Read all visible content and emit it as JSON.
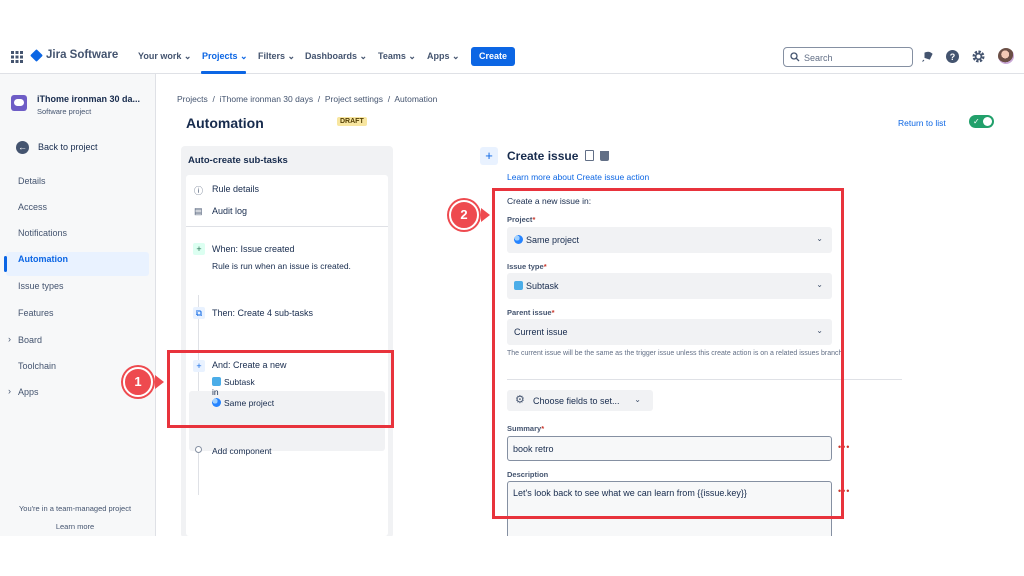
{
  "nav": {
    "brand": "Jira Software",
    "items": [
      "Your work",
      "Projects",
      "Filters",
      "Dashboards",
      "Teams",
      "Apps"
    ],
    "create_label": "Create",
    "search_placeholder": "Search"
  },
  "sidebar": {
    "project_name": "iThome ironman 30 da...",
    "project_type": "Software project",
    "back_label": "Back to project",
    "items": [
      "Details",
      "Access",
      "Notifications",
      "Automation",
      "Issue types",
      "Features",
      "Board",
      "Toolchain",
      "Apps"
    ],
    "active_item": "Automation",
    "team_note": "You're in a team-managed project",
    "learn_more": "Learn more"
  },
  "breadcrumb": [
    "Projects",
    "iThome ironman 30 days",
    "Project settings",
    "Automation"
  ],
  "page": {
    "title": "Automation",
    "status_badge": "DRAFT",
    "return_link": "Return to list",
    "enabled": true
  },
  "rule": {
    "name": "Auto-create sub-tasks",
    "details_label": "Rule details",
    "audit_label": "Audit log",
    "trigger_title": "When: Issue created",
    "trigger_desc": "Rule is run when an issue is created.",
    "action_title": "Then: Create 4 sub-tasks",
    "and_title": "And: Create a new",
    "and_issue_type": "Subtask",
    "and_in": "in",
    "and_project": "Same project",
    "add_component": "Add component"
  },
  "action_panel": {
    "title": "Create issue",
    "learn_link": "Learn more about Create issue action",
    "heading": "Create a new issue in:",
    "project_label": "Project",
    "project_value": "Same project",
    "issue_type_label": "Issue type",
    "issue_type_value": "Subtask",
    "parent_label": "Parent issue",
    "parent_value": "Current issue",
    "help_text": "The current issue will be the same as the trigger issue unless this create action is on a related issues branch.",
    "choose_fields": "Choose fields to set...",
    "summary_label": "Summary",
    "summary_value": "book retro",
    "description_label": "Description",
    "description_value": "Let's look back to see what we can learn from {{issue.key}}",
    "required_mark": "*",
    "more_dots": "•••"
  },
  "annotations": [
    "1",
    "2"
  ],
  "colors": {
    "accent": "#0c66e4",
    "annotation": "#e8333c",
    "toggle_on": "#22a06b"
  }
}
